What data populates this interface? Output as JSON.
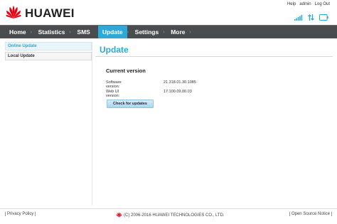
{
  "brand": {
    "name": "HUAWEI",
    "color": "#e60012",
    "logo_icon": "huawei-petal-logo-icon"
  },
  "top_links": {
    "help": "Help",
    "user": "admin",
    "logout": "Log Out"
  },
  "status_icons": [
    "signal-strength-icon",
    "data-transfer-icon",
    "battery-icon"
  ],
  "nav": {
    "items": [
      {
        "label": "Home"
      },
      {
        "label": "Statistics"
      },
      {
        "label": "SMS"
      },
      {
        "label": "Update"
      },
      {
        "label": "Settings"
      },
      {
        "label": "More"
      }
    ],
    "active_index": 3,
    "bar_color": "#4a4d50",
    "active_color": "#2fa7d9"
  },
  "sidebar": {
    "items": [
      {
        "label": "Online Update"
      },
      {
        "label": "Local Update"
      }
    ],
    "active_index": 0
  },
  "main": {
    "title": "Update",
    "section_title": "Current version",
    "rows": [
      {
        "label": "Software version:",
        "value": "21.318.01.30.1085"
      },
      {
        "label": "Web UI version:",
        "value": "17.100.09.00.03"
      }
    ],
    "check_button": "Check for updates"
  },
  "footer": {
    "privacy": "Privacy Policy",
    "copyright": "(C) 2006-2016 HUAWEI TECHNOLOGIES CO., LTD.",
    "open_source": "Open Source Notice"
  }
}
